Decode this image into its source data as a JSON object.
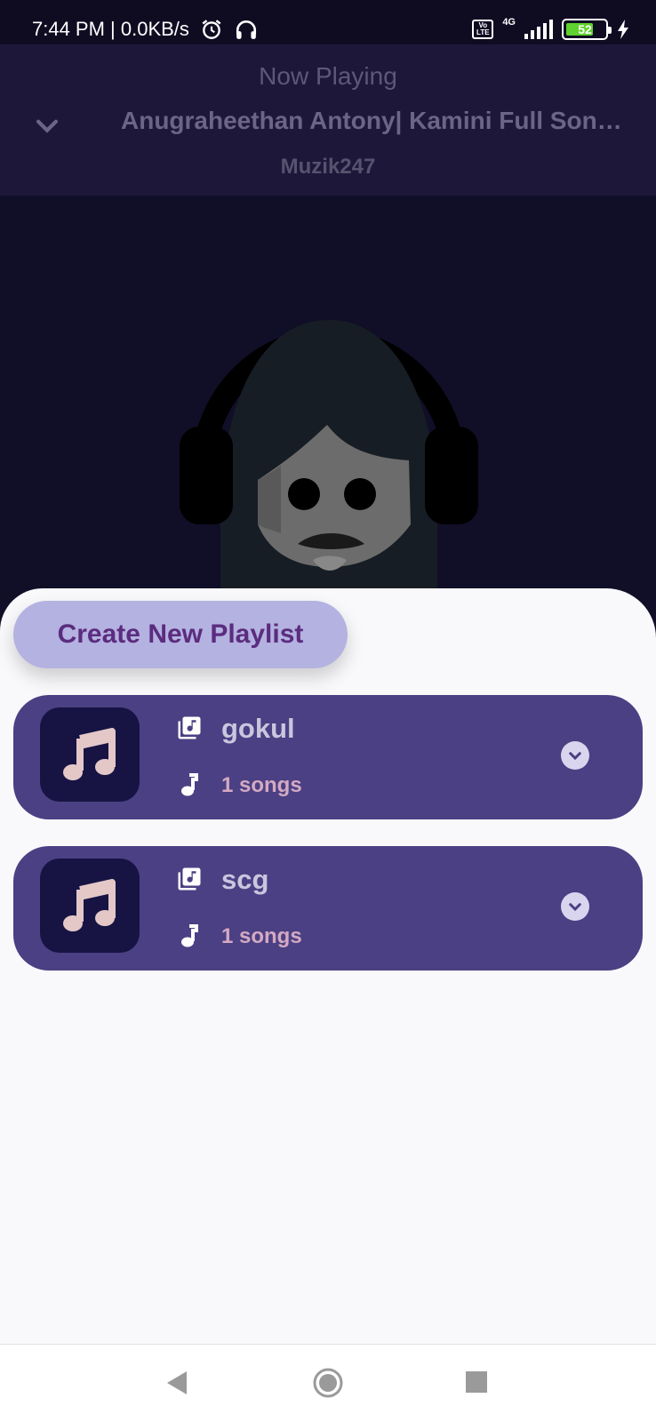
{
  "status_bar": {
    "time_speed": "7:44 PM | 0.0KB/s",
    "volte_label": "Vo\nLTE",
    "network": "4G",
    "battery_level": "52",
    "icons": [
      "alarm-icon",
      "headphones-icon",
      "signal-icon",
      "charging-icon"
    ]
  },
  "now_playing": {
    "label": "Now Playing",
    "title": "Anugraheethan Antony| Kamini Full Song...",
    "artist": "Muzik247"
  },
  "sheet": {
    "create_button_label": "Create New Playlist",
    "playlists": [
      {
        "name": "gokul",
        "count": "1 songs"
      },
      {
        "name": "scg",
        "count": "1 songs"
      }
    ]
  },
  "colors": {
    "accent": "#4a4083",
    "button": "#b4b2e0",
    "button_text": "#5b2c7f",
    "count_text": "#d4a9c3"
  }
}
